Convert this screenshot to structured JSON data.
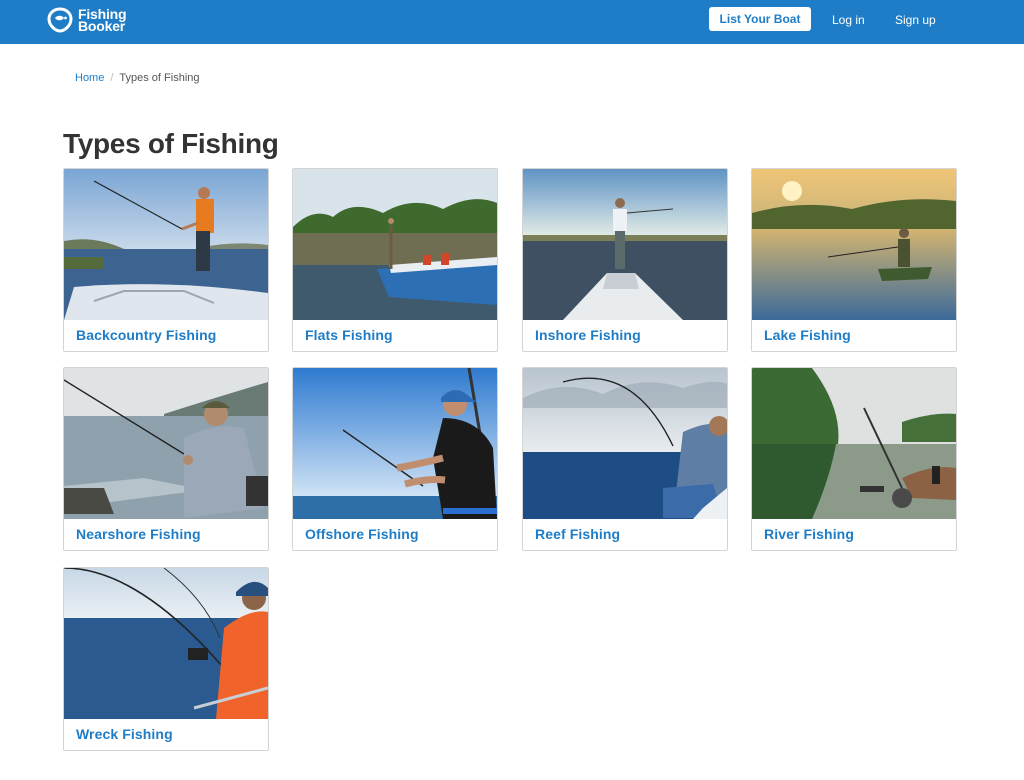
{
  "header": {
    "logo_line1": "Fishing",
    "logo_line2": "Booker",
    "list_boat_label": "List Your Boat",
    "login_label": "Log in",
    "signup_label": "Sign up",
    "brand_color": "#1e7dc6"
  },
  "breadcrumb": {
    "home": "Home",
    "separator": "/",
    "current": "Types of Fishing"
  },
  "page": {
    "title": "Types of Fishing"
  },
  "cards": [
    {
      "label": "Backcountry Fishing",
      "scene": "angler-orange-vest-on-boat-bow"
    },
    {
      "label": "Flats Fishing",
      "scene": "blue-boat-on-calm-water"
    },
    {
      "label": "Inshore Fishing",
      "scene": "angler-casting-from-bow"
    },
    {
      "label": "Lake Fishing",
      "scene": "angler-in-small-boat-at-sunset"
    },
    {
      "label": "Nearshore Fishing",
      "scene": "angler-grey-hoodie-with-rod"
    },
    {
      "label": "Offshore Fishing",
      "scene": "angler-black-shirt-blue-cap"
    },
    {
      "label": "Reef Fishing",
      "scene": "angler-bending-rod-cloudy-sea"
    },
    {
      "label": "River Fishing",
      "scene": "hand-holding-reel-by-river"
    },
    {
      "label": "Wreck Fishing",
      "scene": "angler-orange-shirt-open-sea"
    }
  ]
}
